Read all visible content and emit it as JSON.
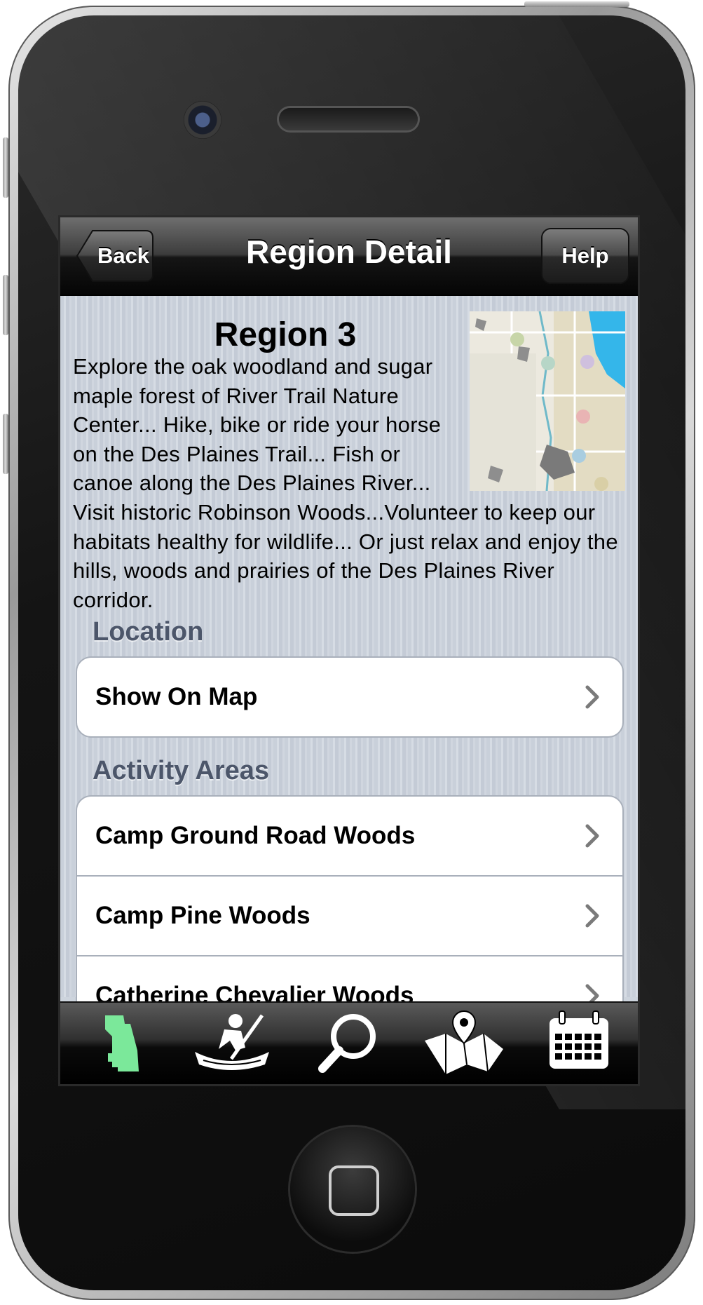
{
  "navbar": {
    "back_label": "Back",
    "title": "Region Detail",
    "help_label": "Help"
  },
  "region": {
    "title": "Region 3",
    "description": "Explore the oak woodland and sugar maple forest of River Trail Nature Center... Hike, bike or ride your horse on the Des Plaines Trail... Fish or canoe along the Des Plaines River... Visit historic Robinson Woods...Volunteer to keep our habitats healthy for wildlife... Or just relax and enjoy the hills, woods and prairies of the Des Plaines River corridor."
  },
  "location": {
    "header": "Location",
    "items": [
      {
        "label": "Show On Map"
      }
    ]
  },
  "activity_areas": {
    "header": "Activity Areas",
    "items": [
      {
        "label": "Camp Ground Road Woods"
      },
      {
        "label": "Camp Pine Woods"
      },
      {
        "label": "Catherine Chevalier Woods"
      }
    ]
  },
  "tabbar": {
    "items": [
      {
        "icon": "county-map-icon",
        "selected": true
      },
      {
        "icon": "canoe-icon",
        "selected": false
      },
      {
        "icon": "search-icon",
        "selected": false
      },
      {
        "icon": "map-pin-icon",
        "selected": false
      },
      {
        "icon": "calendar-icon",
        "selected": false
      }
    ]
  },
  "colors": {
    "selected_tab": "#7be89a",
    "section_header": "#4c566a"
  }
}
